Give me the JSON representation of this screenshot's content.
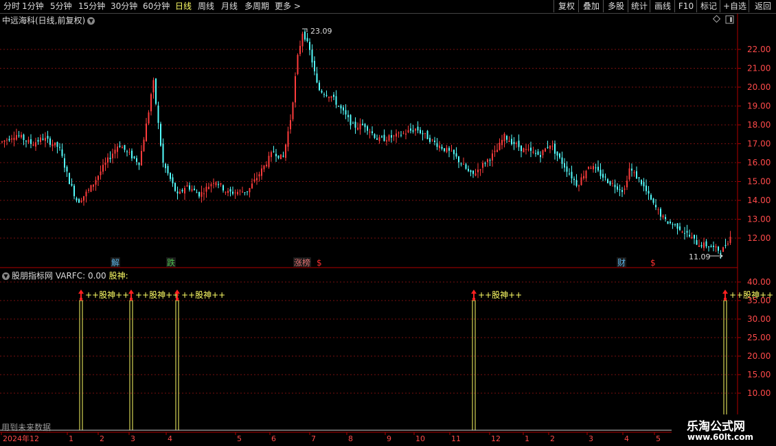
{
  "toolbar": {
    "periods": [
      "分时",
      "1分钟",
      "5分钟",
      "15分钟",
      "30分钟",
      "60分钟",
      "日线",
      "周线",
      "月线",
      "多周期",
      "更多"
    ],
    "active_period": "日线",
    "more_arrow": ">",
    "right_buttons": [
      "复权",
      "叠加",
      "多股",
      "统计",
      "画线",
      "F10",
      "标记",
      "+自选",
      "返回"
    ]
  },
  "main_chart": {
    "title": "中远海科(日线,前复权)",
    "y_ticks": [
      "22.00",
      "21.00",
      "20.00",
      "19.00",
      "18.00",
      "17.00",
      "16.00",
      "15.00",
      "14.00",
      "13.00",
      "12.00"
    ],
    "high_label": "23.09",
    "low_label": "11.09",
    "event_markers": [
      {
        "label": "解",
        "color": "#5ab4e8"
      },
      {
        "label": "跌",
        "color": "#4ec04e"
      },
      {
        "label": "涨榜",
        "color": "#e07070"
      },
      {
        "label": "$",
        "color": "#ff3030"
      },
      {
        "label": "财",
        "color": "#5ab4e8"
      },
      {
        "label": "$",
        "color": "#ff3030"
      }
    ]
  },
  "sub_chart": {
    "title": "股朋指标网 VARFC: 0.00",
    "indicator_name": "股神:",
    "signal_label": "++股神++",
    "y_ticks": [
      "40.00",
      "35.00",
      "30.00",
      "25.00",
      "20.00",
      "15.00",
      "10.00"
    ],
    "signal_value": 35.0
  },
  "x_axis": {
    "labels": [
      "2024年12",
      "1",
      "2",
      "3",
      "4",
      "5",
      "6",
      "7",
      "8",
      "9",
      "10",
      "11",
      "12",
      "1",
      "2",
      "3",
      "4",
      "5",
      "6"
    ]
  },
  "footer_note": "用到未来数据",
  "watermark": {
    "line1": "乐淘公式网",
    "line2": "www.60lt.com"
  },
  "colors": {
    "up": "#ff3c3c",
    "down": "#54ffff",
    "signal_bar": "#ffff66",
    "grid": "#7a1010",
    "axis": "#b00000",
    "active_tab": "#ffff66"
  }
}
